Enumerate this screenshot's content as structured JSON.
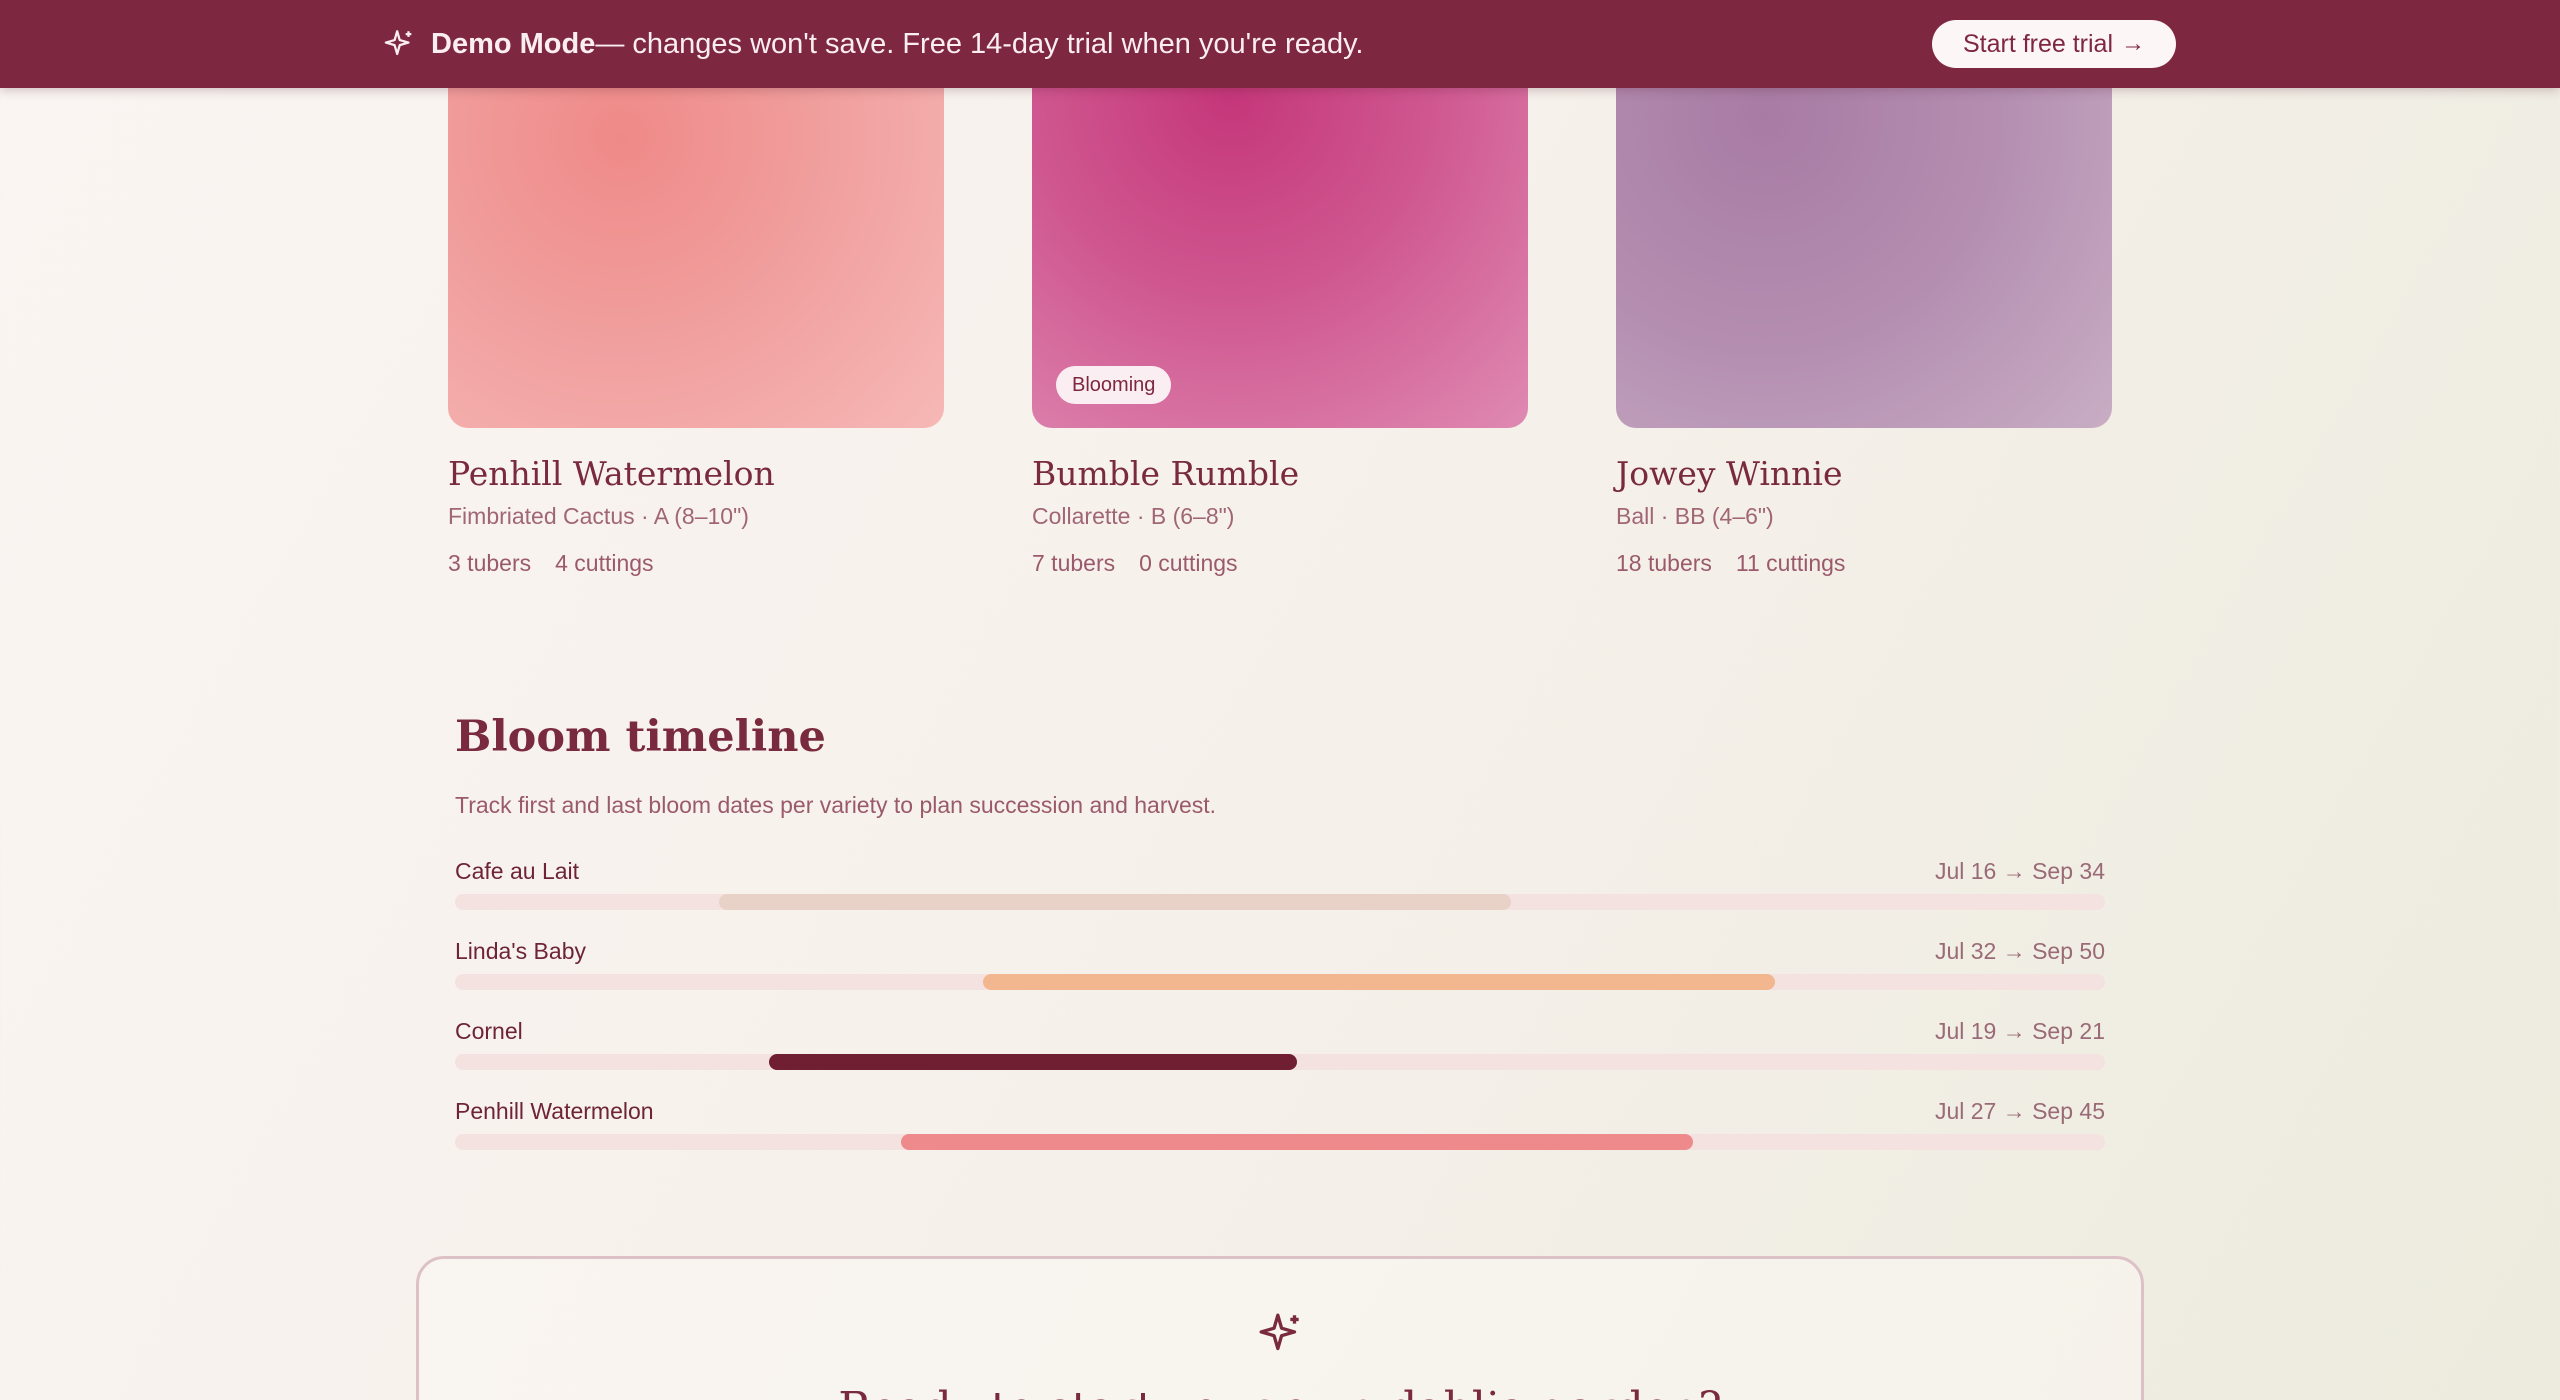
{
  "banner": {
    "icon": "sparkle-icon",
    "mode_label": "Demo Mode",
    "message": " — changes won't save. Free 14-day trial when you're ready.",
    "cta_label": "Start free trial",
    "cta_arrow": "→"
  },
  "varieties": [
    {
      "name": "Penhill Watermelon",
      "subtitle": "Fimbriated Cactus · A (8–10\")",
      "tubers": "3 tubers",
      "cuttings": "4 cuttings",
      "badge": ""
    },
    {
      "name": "Bumble Rumble",
      "subtitle": "Collarette · B (6–8\")",
      "tubers": "7 tubers",
      "cuttings": "0 cuttings",
      "badge": "Blooming"
    },
    {
      "name": "Jowey Winnie",
      "subtitle": "Ball · BB (4–6\")",
      "tubers": "18 tubers",
      "cuttings": "11 cuttings",
      "badge": ""
    }
  ],
  "timeline": {
    "title": "Bloom timeline",
    "description": "Track first and last bloom dates per variety to plan succession and harvest.",
    "rows": [
      {
        "name": "Cafe au Lait",
        "range": "Jul 16 → Sep 34",
        "start": 0.16,
        "end": 0.64,
        "color": "#e8d2c8"
      },
      {
        "name": "Linda's Baby",
        "range": "Jul 32 → Sep 50",
        "start": 0.32,
        "end": 0.8,
        "color": "#f2b78f"
      },
      {
        "name": "Cornel",
        "range": "Jul 19 → Sep 21",
        "start": 0.19,
        "end": 0.51,
        "color": "#701f33"
      },
      {
        "name": "Penhill Watermelon",
        "range": "Jul 27 → Sep 45",
        "start": 0.27,
        "end": 0.75,
        "color": "#ee8a8c"
      }
    ]
  },
  "cta": {
    "icon": "sparkle-icon",
    "heading": "Ready to start your own dahlia garden?"
  },
  "colors": {
    "banner": "#7e2740",
    "accent": "#7a2a3e",
    "track": "#f3e2e0"
  }
}
